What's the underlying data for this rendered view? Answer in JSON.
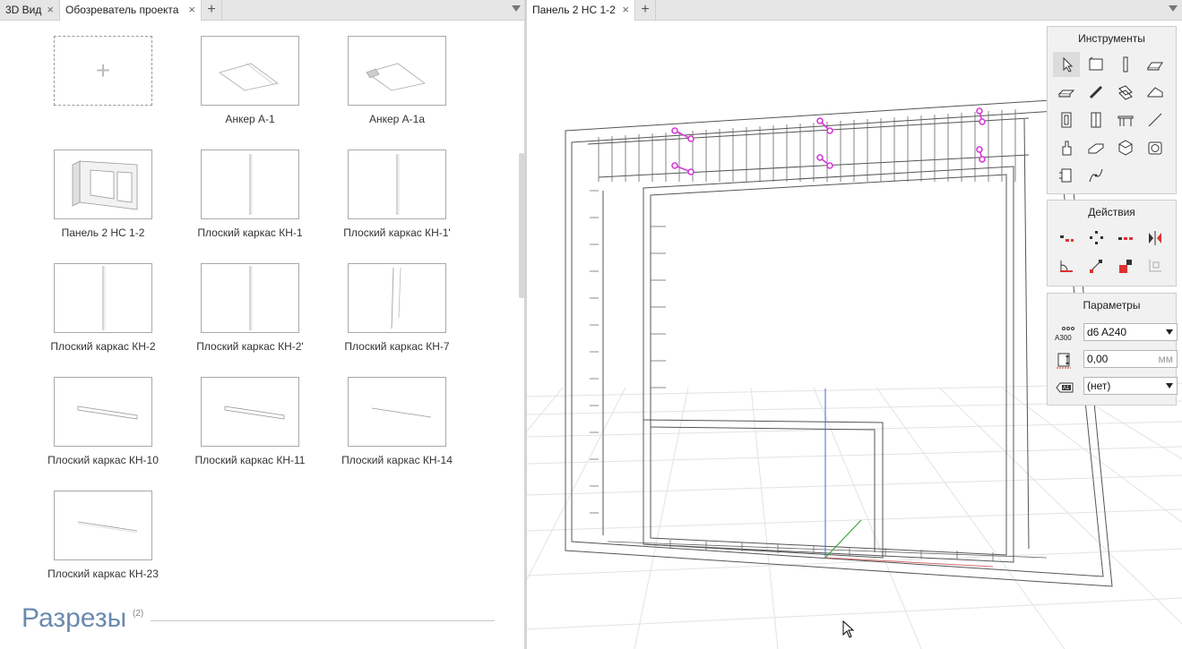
{
  "left_tabs": [
    {
      "label": "3D Вид"
    },
    {
      "label": "Обозреватель проекта"
    }
  ],
  "right_tabs": [
    {
      "label": "Панель 2 НС 1-2"
    }
  ],
  "add_card": {
    "label": "+"
  },
  "items": [
    {
      "label": "Анкер А-1"
    },
    {
      "label": "Анкер А-1а"
    },
    {
      "label": "Панель 2 НС 1-2"
    },
    {
      "label": "Плоский каркас КН-1"
    },
    {
      "label": "Плоский каркас КН-1'"
    },
    {
      "label": "Плоский каркас КН-2"
    },
    {
      "label": "Плоский каркас КН-2'"
    },
    {
      "label": "Плоский каркас КН-7"
    },
    {
      "label": "Плоский каркас КН-10"
    },
    {
      "label": "Плоский каркас КН-11"
    },
    {
      "label": "Плоский каркас КН-14"
    },
    {
      "label": "Плоский каркас КН-23"
    }
  ],
  "section": {
    "title": "Разрезы",
    "count": "(2)"
  },
  "instruments": {
    "title": "Инструменты",
    "tools": [
      "select-icon",
      "wall-icon",
      "column-icon",
      "slab-icon",
      "beam-icon",
      "rebar-icon",
      "mesh-icon",
      "roof-icon",
      "window-icon",
      "door-icon",
      "stair-icon",
      "line-icon",
      "object-icon",
      "opening-icon",
      "polyhedron-icon",
      "camera-icon",
      "section-icon",
      "curve-icon"
    ]
  },
  "actions": {
    "title": "Действия",
    "tools": [
      "move-icon",
      "scatter-icon",
      "array-icon",
      "mirror-icon",
      "rotate-icon",
      "align-icon",
      "scale-icon",
      "copy-props-icon"
    ]
  },
  "parameters": {
    "title": "Параметры",
    "rebar_value": "d6 A240",
    "rebar_icon_label": "A300",
    "offset_value": "0,00",
    "offset_unit": "мм",
    "layer_value": "(нет)",
    "layer_icon_label": "A1"
  },
  "colors": {
    "accent_title": "#6b8ab0",
    "handle": "#d63ad6"
  }
}
